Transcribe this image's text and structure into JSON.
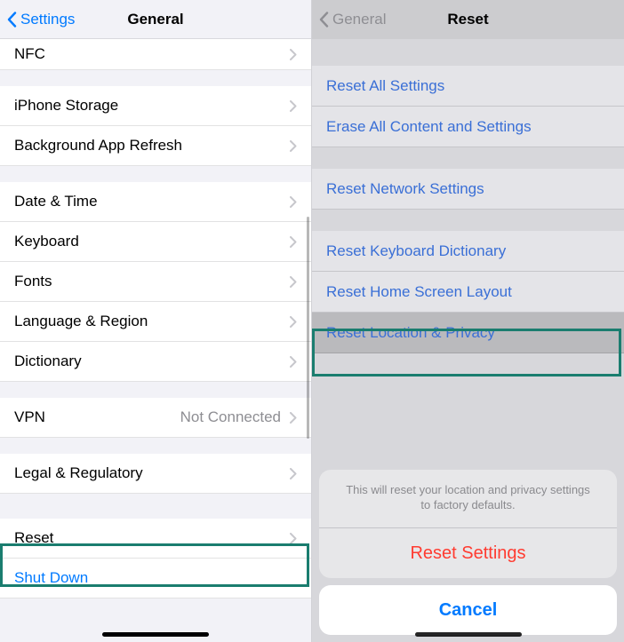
{
  "left": {
    "back_label": "Settings",
    "title": "General",
    "rows": {
      "nfc": "NFC",
      "iphone_storage": "iPhone Storage",
      "bg_app_refresh": "Background App Refresh",
      "date_time": "Date & Time",
      "keyboard": "Keyboard",
      "fonts": "Fonts",
      "language_region": "Language & Region",
      "dictionary": "Dictionary",
      "vpn": "VPN",
      "vpn_value": "Not Connected",
      "legal": "Legal & Regulatory",
      "reset": "Reset",
      "shutdown": "Shut Down"
    }
  },
  "right": {
    "back_label": "General",
    "title": "Reset",
    "rows": {
      "reset_all": "Reset All Settings",
      "erase_all": "Erase All Content and Settings",
      "reset_network": "Reset Network Settings",
      "reset_keyboard": "Reset Keyboard Dictionary",
      "reset_home": "Reset Home Screen Layout",
      "reset_location": "Reset Location & Privacy"
    },
    "sheet": {
      "message": "This will reset your location and privacy settings to factory defaults.",
      "action": "Reset Settings",
      "cancel": "Cancel"
    }
  }
}
